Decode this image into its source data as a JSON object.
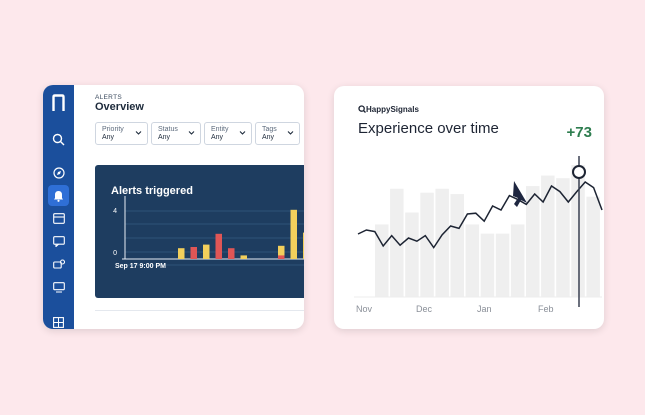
{
  "left_card": {
    "section": "ALERTS",
    "title": "Overview",
    "filters": [
      {
        "label": "Priority",
        "value": "Any"
      },
      {
        "label": "Status",
        "value": "Any"
      },
      {
        "label": "Entity",
        "value": "Any"
      },
      {
        "label": "Tags",
        "value": "Any"
      }
    ],
    "sidebar_icons": [
      "logo-icon",
      "search-icon",
      "compass-icon",
      "bell-icon",
      "dashboard-icon",
      "chat-icon",
      "devices-icon",
      "monitor-icon",
      "grid-icon"
    ],
    "panel_title": "Alerts triggered",
    "chart_data": {
      "type": "bar",
      "title": "Alerts triggered",
      "y_ticks": [
        "4",
        "0"
      ],
      "ylim": [
        0,
        4
      ],
      "x_tick_label": "Sep 17 9:00 PM",
      "series": [
        {
          "color": "#f2cf5c",
          "values": [
            0,
            0,
            0.9,
            0,
            1.2,
            0,
            0,
            0.3,
            0,
            0,
            1.1,
            4.1,
            2.2
          ]
        },
        {
          "color": "#e05656",
          "values": [
            0,
            0,
            0,
            1,
            0,
            2.1,
            0.9,
            0,
            0,
            0,
            0.3,
            0,
            0
          ]
        }
      ]
    },
    "colors": {
      "sidebar": "#1b4f9c",
      "panel": "#1e3d60",
      "accent": "#2f6fd6"
    }
  },
  "right_card": {
    "brand": "HappySignals",
    "title": "Experience over time",
    "delta": "+73",
    "chart_data": {
      "type": "line",
      "x_tick_labels": [
        "Nov",
        "Dec",
        "Jan",
        "Feb"
      ],
      "bars_relative": [
        0.55,
        0.82,
        0.64,
        0.79,
        0.82,
        0.78,
        0.55,
        0.48,
        0.48,
        0.55,
        0.84,
        0.92,
        0.9,
        1.0,
        0.76
      ],
      "line_relative": [
        0.5,
        0.55,
        0.53,
        0.35,
        0.48,
        0.36,
        0.45,
        0.41,
        0.48,
        0.33,
        0.49,
        0.6,
        0.57,
        0.75,
        0.76,
        0.66,
        0.85,
        0.8,
        0.98,
        0.93,
        0.87,
        1.0,
        0.9,
        1.1,
        1.03,
        0.9,
        1.03,
        1.15,
        1.08,
        0.8
      ],
      "highlight_index": 27
    },
    "colors": {
      "delta": "#2e7d4f",
      "bar": "#efefef",
      "line": "#1d2433"
    }
  }
}
